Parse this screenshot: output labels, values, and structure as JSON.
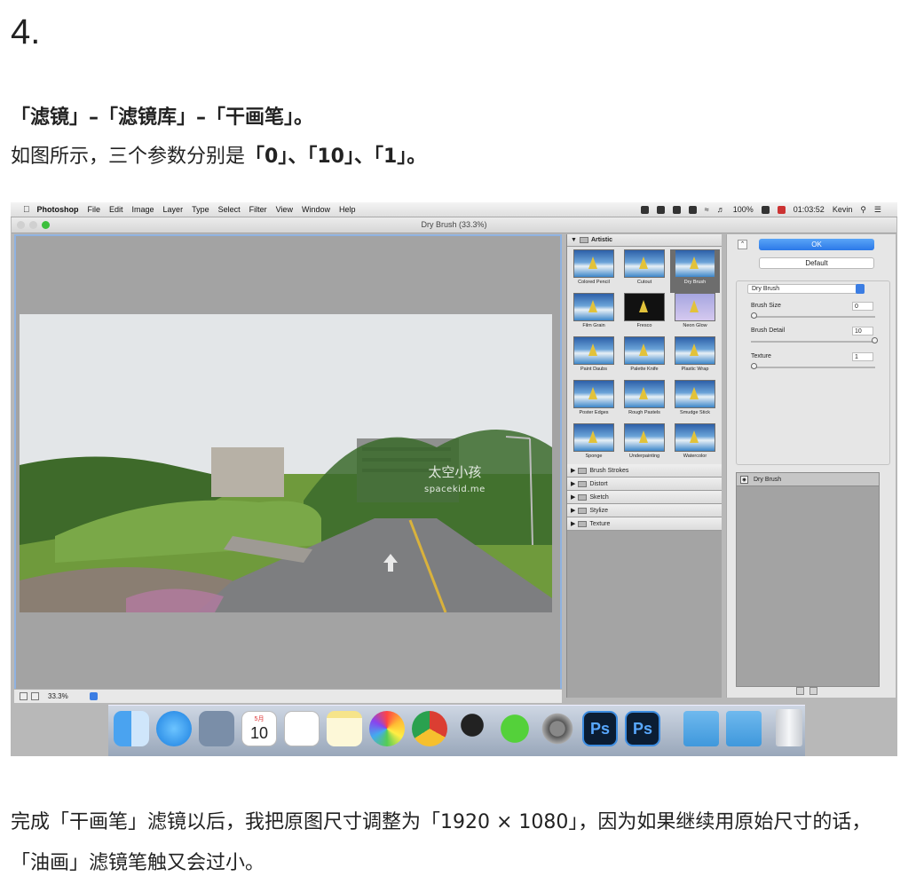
{
  "article": {
    "step_number": "4.",
    "menu_path": "「滤镜」–「滤镜库」–「干画笔」。",
    "params_intro": "如图所示，三个参数分别是",
    "params_value": "「0」、「10」、「1」。",
    "closing_text": "完成「干画笔」滤镜以后，我把原图尺寸调整为「1920 × 1080」，因为如果继续用原始尺寸的话，「油画」滤镜笔触又会过小。"
  },
  "menubar": {
    "items": [
      "Photoshop",
      "File",
      "Edit",
      "Image",
      "Layer",
      "Type",
      "Select",
      "Filter",
      "View",
      "Window",
      "Help"
    ],
    "battery": "100%",
    "time": "01:03:52",
    "user": "Kevin"
  },
  "window": {
    "title": "Dry Brush (33.3%)"
  },
  "preview": {
    "zoom": "33.3%",
    "watermark_line1": "太空小孩",
    "watermark_line2": "spacekid.me"
  },
  "gallery": {
    "open_category": "Artistic",
    "thumbnails": [
      "Colored Pencil",
      "Cutout",
      "Dry Brush",
      "Film Grain",
      "Fresco",
      "Neon Glow",
      "Paint Daubs",
      "Palette Knife",
      "Plastic Wrap",
      "Poster Edges",
      "Rough Pastels",
      "Smudge Stick",
      "Sponge",
      "Underpainting",
      "Watercolor"
    ],
    "selected": "Dry Brush",
    "categories": [
      "Brush Strokes",
      "Distort",
      "Sketch",
      "Stylize",
      "Texture"
    ]
  },
  "settings": {
    "ok_label": "OK",
    "default_label": "Default",
    "filter_select": "Dry Brush",
    "params": [
      {
        "label": "Brush Size",
        "value": "0",
        "level": 0.0
      },
      {
        "label": "Brush Detail",
        "value": "10",
        "level": 1.0
      },
      {
        "label": "Texture",
        "value": "1",
        "level": 0.0
      }
    ],
    "layer_name": "Dry Brush"
  },
  "colors": {
    "accent_blue": "#2b78e8",
    "ps_icon_bg": "#0b1d33"
  },
  "dock": {
    "icons": [
      "finder-icon",
      "messages-icon",
      "preview-icon",
      "calendar-icon",
      "reminders-icon",
      "notes-icon",
      "photos-icon",
      "chrome-icon",
      "qq-icon",
      "wechat-icon",
      "system-preferences-icon",
      "photoshop-icon",
      "photoshop-icon",
      "applications-folder-icon",
      "downloads-folder-icon",
      "trash-icon"
    ],
    "calendar_month": "5月",
    "calendar_day": "10",
    "ps_label": "Ps"
  }
}
